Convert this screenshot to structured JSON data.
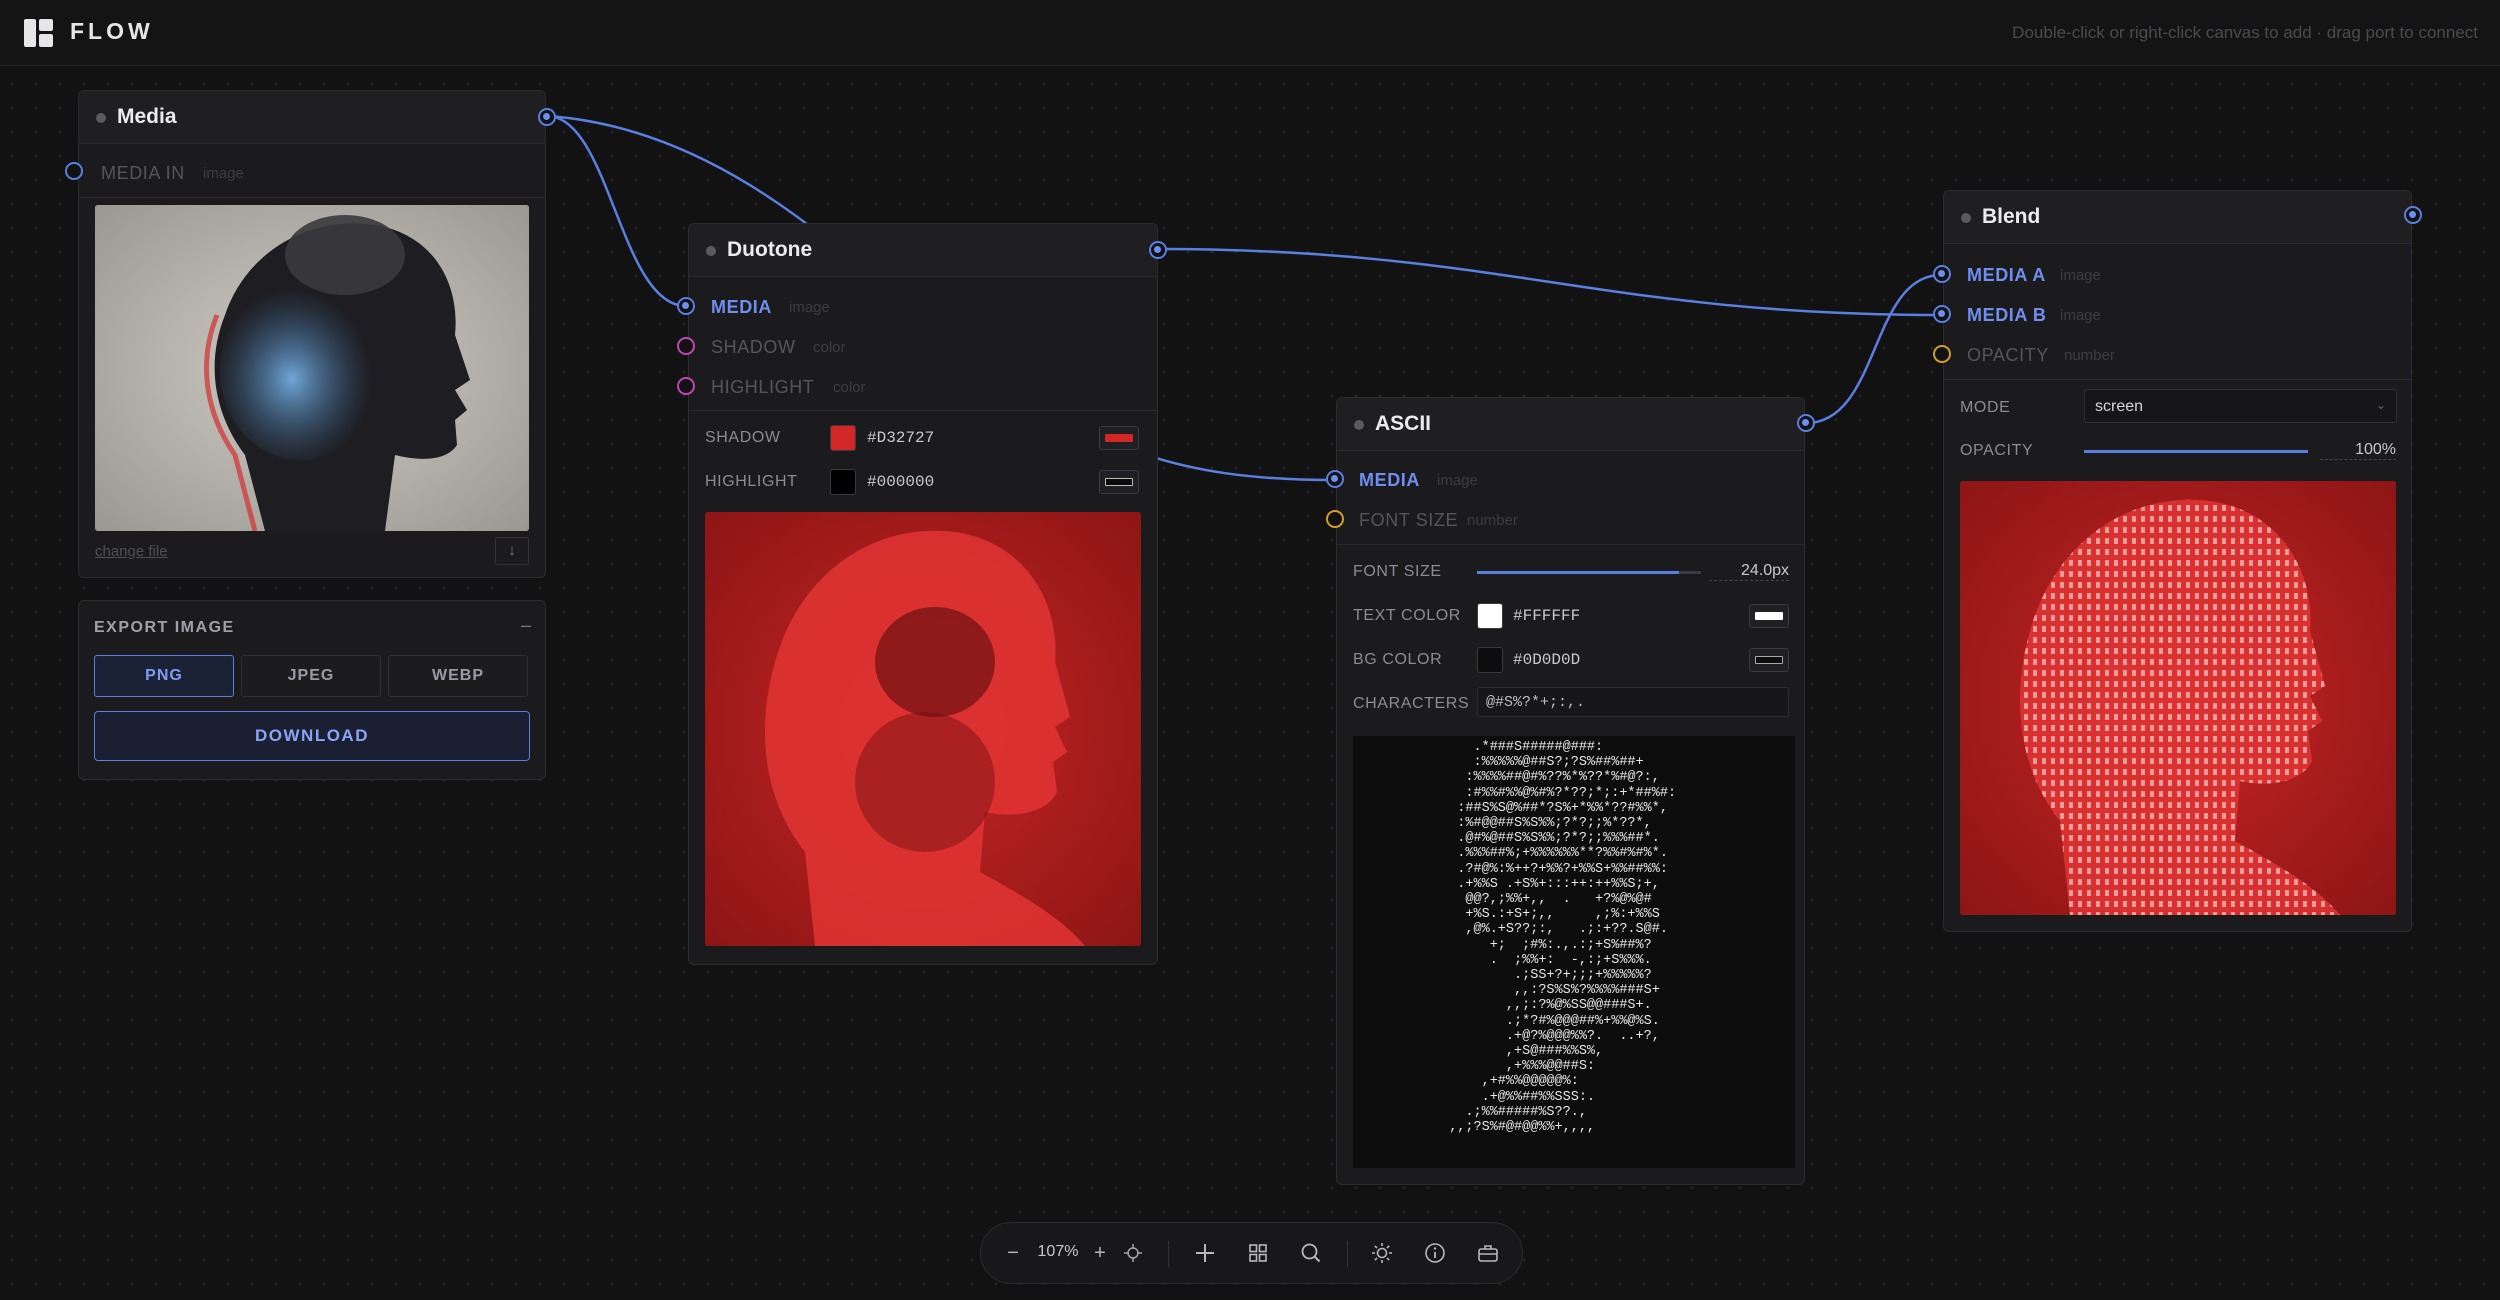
{
  "app": {
    "name": "FLOW",
    "hint": "Double-click or right-click canvas to add · drag port to connect"
  },
  "colors": {
    "accent": "#5B7FE0",
    "port_pink": "#C046B6",
    "port_orange": "#D99A30"
  },
  "nodes": {
    "media": {
      "title": "Media",
      "input_label": "MEDIA IN",
      "input_type": "image",
      "change_label": "change file"
    },
    "export": {
      "title": "EXPORT IMAGE",
      "formats": [
        "PNG",
        "JPEG",
        "WEBP"
      ],
      "selected_format": "PNG",
      "download_label": "DOWNLOAD"
    },
    "duotone": {
      "title": "Duotone",
      "inputs": [
        {
          "label": "MEDIA",
          "type": "image"
        },
        {
          "label": "SHADOW",
          "type": "color"
        },
        {
          "label": "HIGHLIGHT",
          "type": "color"
        }
      ],
      "shadow_label": "SHADOW",
      "shadow_hex": "#D32727",
      "highlight_label": "HIGHLIGHT",
      "highlight_hex": "#000000"
    },
    "ascii": {
      "title": "ASCII",
      "inputs": [
        {
          "label": "MEDIA",
          "type": "number_hidden"
        },
        {
          "label": "FONT SIZE",
          "type": "number"
        }
      ],
      "media_type": "image",
      "font_size_label": "FONT SIZE",
      "font_size_value": "24.0px",
      "font_size_fraction": 0.9,
      "text_color_label": "TEXT COLOR",
      "text_color_hex": "#FFFFFF",
      "bg_color_label": "BG COLOR",
      "bg_color_hex": "#0D0D0D",
      "characters_label": "CHARACTERS",
      "characters_value": "@#S%?*+;:,."
    },
    "blend": {
      "title": "Blend",
      "inputs": [
        {
          "label": "MEDIA A",
          "type": "image"
        },
        {
          "label": "MEDIA B",
          "type": "image"
        },
        {
          "label": "OPACITY",
          "type": "number"
        }
      ],
      "mode_label": "MODE",
      "mode_value": "screen",
      "opacity_label": "OPACITY",
      "opacity_value": "100%",
      "opacity_fraction": 1.0
    }
  },
  "toolbar": {
    "zoom_out": "−",
    "zoom": "107%",
    "zoom_in": "+",
    "icons": [
      "crosshair-icon",
      "add-node-icon",
      "grid-icon",
      "search-icon",
      "sun-icon",
      "info-icon",
      "export-icon"
    ]
  }
}
